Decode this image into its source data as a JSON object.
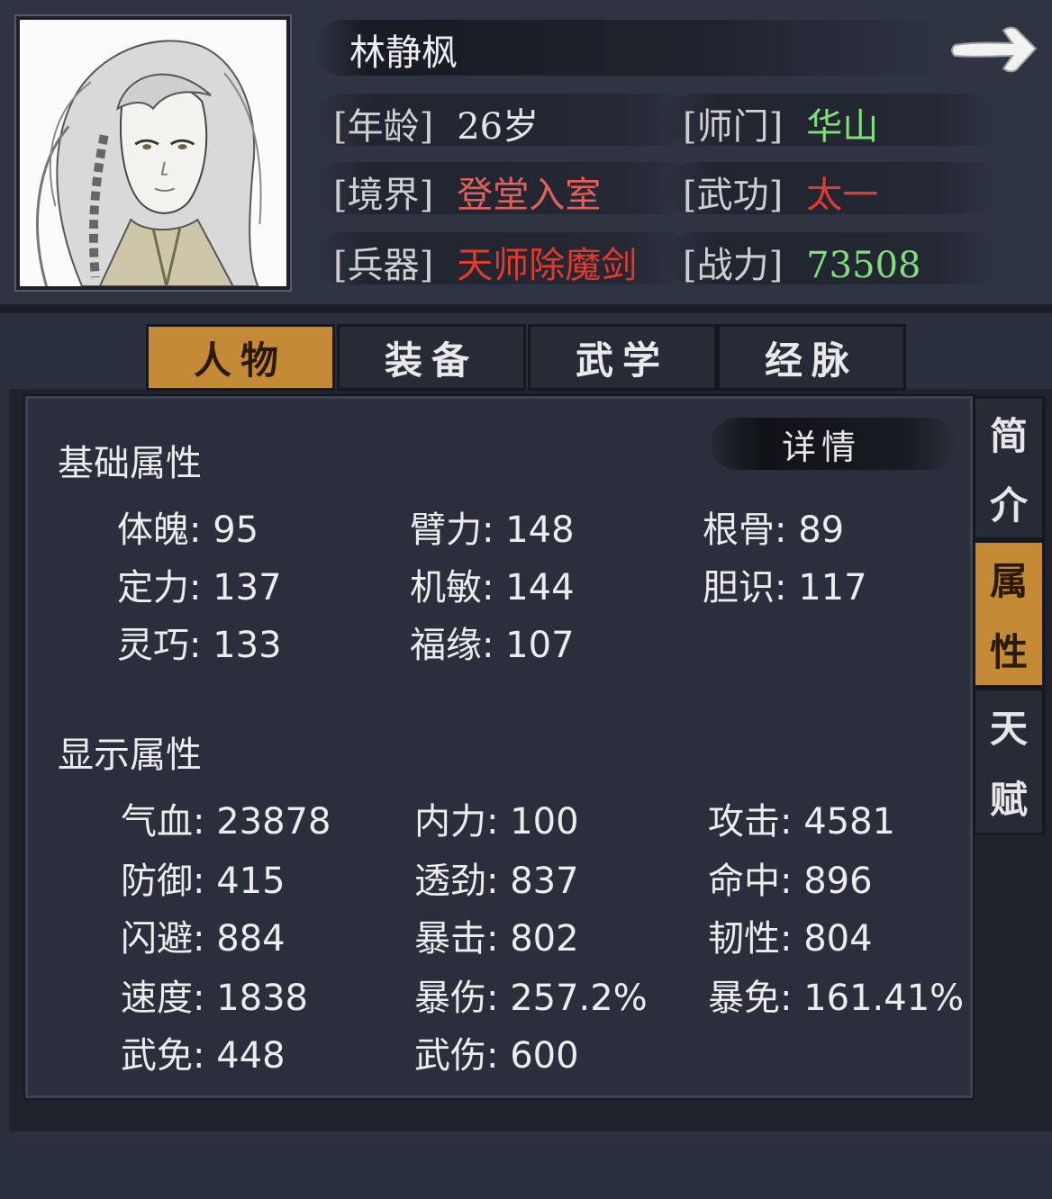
{
  "character": {
    "name": "林静枫",
    "age_label": "[年龄]",
    "age_value": "26岁",
    "sect_label": "[师门]",
    "sect_value": "华山",
    "realm_label": "[境界]",
    "realm_value": "登堂入室",
    "martial_label": "[武功]",
    "martial_value": "太一",
    "weapon_label": "[兵器]",
    "weapon_value": "天师除魔剑",
    "power_label": "[战力]",
    "power_value": "73508"
  },
  "icons": {
    "next": "arrow-right-icon",
    "portrait": "character-portrait"
  },
  "colors": {
    "accent": "#c48a36",
    "green": "#7fe07a",
    "red": "#e23a2e"
  },
  "tabs": [
    {
      "label": "人物",
      "active": true
    },
    {
      "label": "装备",
      "active": false
    },
    {
      "label": "武学",
      "active": false
    },
    {
      "label": "经脉",
      "active": false
    }
  ],
  "side_tabs": [
    {
      "label": "简介",
      "chars": [
        "简",
        "介"
      ],
      "active": false
    },
    {
      "label": "属性",
      "chars": [
        "属",
        "性"
      ],
      "active": true
    },
    {
      "label": "天赋",
      "chars": [
        "天",
        "赋"
      ],
      "active": false
    }
  ],
  "detail_label": "详情",
  "basic": {
    "title": "基础属性",
    "stats": [
      {
        "text": "体魄: 95"
      },
      {
        "text": "臂力: 148"
      },
      {
        "text": "根骨: 89"
      },
      {
        "text": "定力: 137"
      },
      {
        "text": "机敏: 144"
      },
      {
        "text": "胆识: 117"
      },
      {
        "text": "灵巧: 133"
      },
      {
        "text": "福缘: 107"
      }
    ]
  },
  "display": {
    "title": "显示属性",
    "stats": [
      {
        "text": "气血: 23878"
      },
      {
        "text": "内力: 100"
      },
      {
        "text": "攻击: 4581"
      },
      {
        "text": "防御: 415"
      },
      {
        "text": "透劲: 837"
      },
      {
        "text": "命中: 896"
      },
      {
        "text": "闪避: 884"
      },
      {
        "text": "暴击: 802"
      },
      {
        "text": "韧性: 804"
      },
      {
        "text": "速度: 1838"
      },
      {
        "text": "暴伤: 257.2%"
      },
      {
        "text": "暴免: 161.41%"
      },
      {
        "text": "武免: 448"
      },
      {
        "text": "武伤: 600"
      }
    ]
  }
}
